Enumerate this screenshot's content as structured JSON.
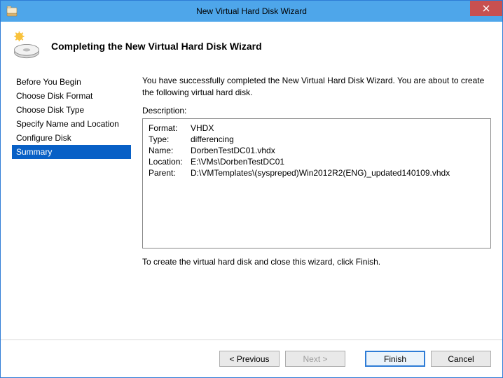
{
  "window": {
    "title": "New Virtual Hard Disk Wizard"
  },
  "header": {
    "page_title": "Completing the New Virtual Hard Disk Wizard"
  },
  "sidebar": {
    "items": [
      {
        "label": "Before You Begin"
      },
      {
        "label": "Choose Disk Format"
      },
      {
        "label": "Choose Disk Type"
      },
      {
        "label": "Specify Name and Location"
      },
      {
        "label": "Configure Disk"
      },
      {
        "label": "Summary"
      }
    ],
    "selected_index": 5
  },
  "content": {
    "intro": "You have successfully completed the New Virtual Hard Disk Wizard. You are about to create the following virtual hard disk.",
    "description_label": "Description:",
    "description": [
      {
        "key": "Format:",
        "value": "VHDX"
      },
      {
        "key": "Type:",
        "value": "differencing"
      },
      {
        "key": "Name:",
        "value": "DorbenTestDC01.vhdx"
      },
      {
        "key": "Location:",
        "value": "E:\\VMs\\DorbenTestDC01"
      },
      {
        "key": "Parent:",
        "value": "D:\\VMTemplates\\(syspreped)Win2012R2(ENG)_updated140109.vhdx"
      }
    ],
    "instruction": "To create the virtual hard disk and close this wizard, click Finish."
  },
  "footer": {
    "previous": "< Previous",
    "next": "Next >",
    "finish": "Finish",
    "cancel": "Cancel",
    "next_enabled": false
  }
}
